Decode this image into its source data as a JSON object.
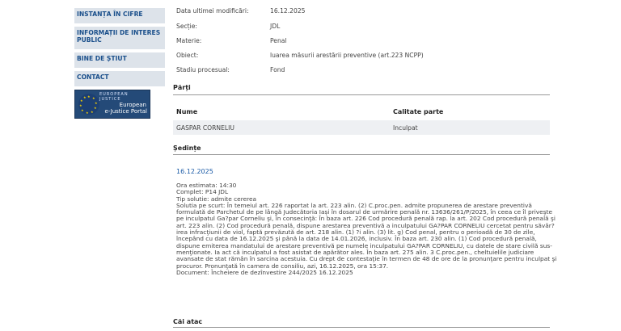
{
  "sidebar": {
    "items": [
      "INSTANȚA ÎN CIFRE",
      "INFORMAȚII DE INTERES PUBLIC",
      "BINE DE ȘTIUT",
      "CONTACT"
    ],
    "banner": {
      "top": "EUROPEAN JUSTICE",
      "line1": "European",
      "line2": "e-Justice Portal"
    }
  },
  "details": [
    {
      "label": "Data ultimei modificări:",
      "value": "16.12.2025"
    },
    {
      "label": "Secție:",
      "value": "JDL"
    },
    {
      "label": "Materie:",
      "value": "Penal"
    },
    {
      "label": "Obiect:",
      "value": "luarea măsurii arestării preventive (art.223 NCPP)"
    },
    {
      "label": "Stadiu procesual:",
      "value": "Fond"
    }
  ],
  "parti": {
    "title": "Părți",
    "col_name": "Nume",
    "col_role": "Calitate parte",
    "rows": [
      {
        "name": "GASPAR CORNELIU",
        "role": "Inculpat"
      }
    ]
  },
  "sedinte": {
    "title": "Ședințe",
    "date": "16.12.2025",
    "lines": [
      "Ora estimata: 14:30",
      "Complet: P14 JDL",
      "Tip solutie: admite cererea",
      "Solutia pe scurt: În temeiul art. 226 raportat la art. 223 alin. (2) C.proc.pen. admite propunerea de arestare preventivă",
      "formulată de Parchetul de pe lângă Judecătoria Iași în dosarul de urmărire penală nr. 13636/261/P/2025, în ceea ce îl priveşte",
      "pe inculpatul Ga?par Corneliu şi, în consecinţă: În baza art. 226 Cod procedură penală rap. la art. 202 Cod procedură penală şi",
      "art. 223 alin. (2) Cod procedură penală, dispune arestarea preventivă a inculpatului GA?PAR CORNELIU cercetat pentru săvâr?",
      "irea infracţiunii de viol, faptă prevăzută de art. 218 alin. (1) ?i alin. (3) lit. g) Cod penal, pentru o perioadă de 30 de zile,",
      "începând cu data de 16.12.2025 şi până la data de 14.01.2026, inclusiv. În baza art. 230 alin. (1) Cod procedură penală,",
      "dispune emiterea mandatului de arestare preventivă pe numele inculpatului GA?PAR CORNELIU, cu datele de stare civilă sus-",
      "menţionate. Ia act că inculpatul a fost asistat de apărător ales. În baza art. 275 alin. 3 C.proc.pen., cheltuielile judiciare",
      "avansate de stat rămân în sarcina acestuia. Cu drept de contestaţie în termen de 48 de ore de la pronunţare pentru inculpat şi",
      "procuror. Pronunţată în camera de consiliu, azi, 16.12.2025, ora 15:37.",
      "Document: Încheiere de dezînvestire  244/2025  16.12.2025"
    ]
  },
  "cai_atac": {
    "title": "Căi atac"
  }
}
